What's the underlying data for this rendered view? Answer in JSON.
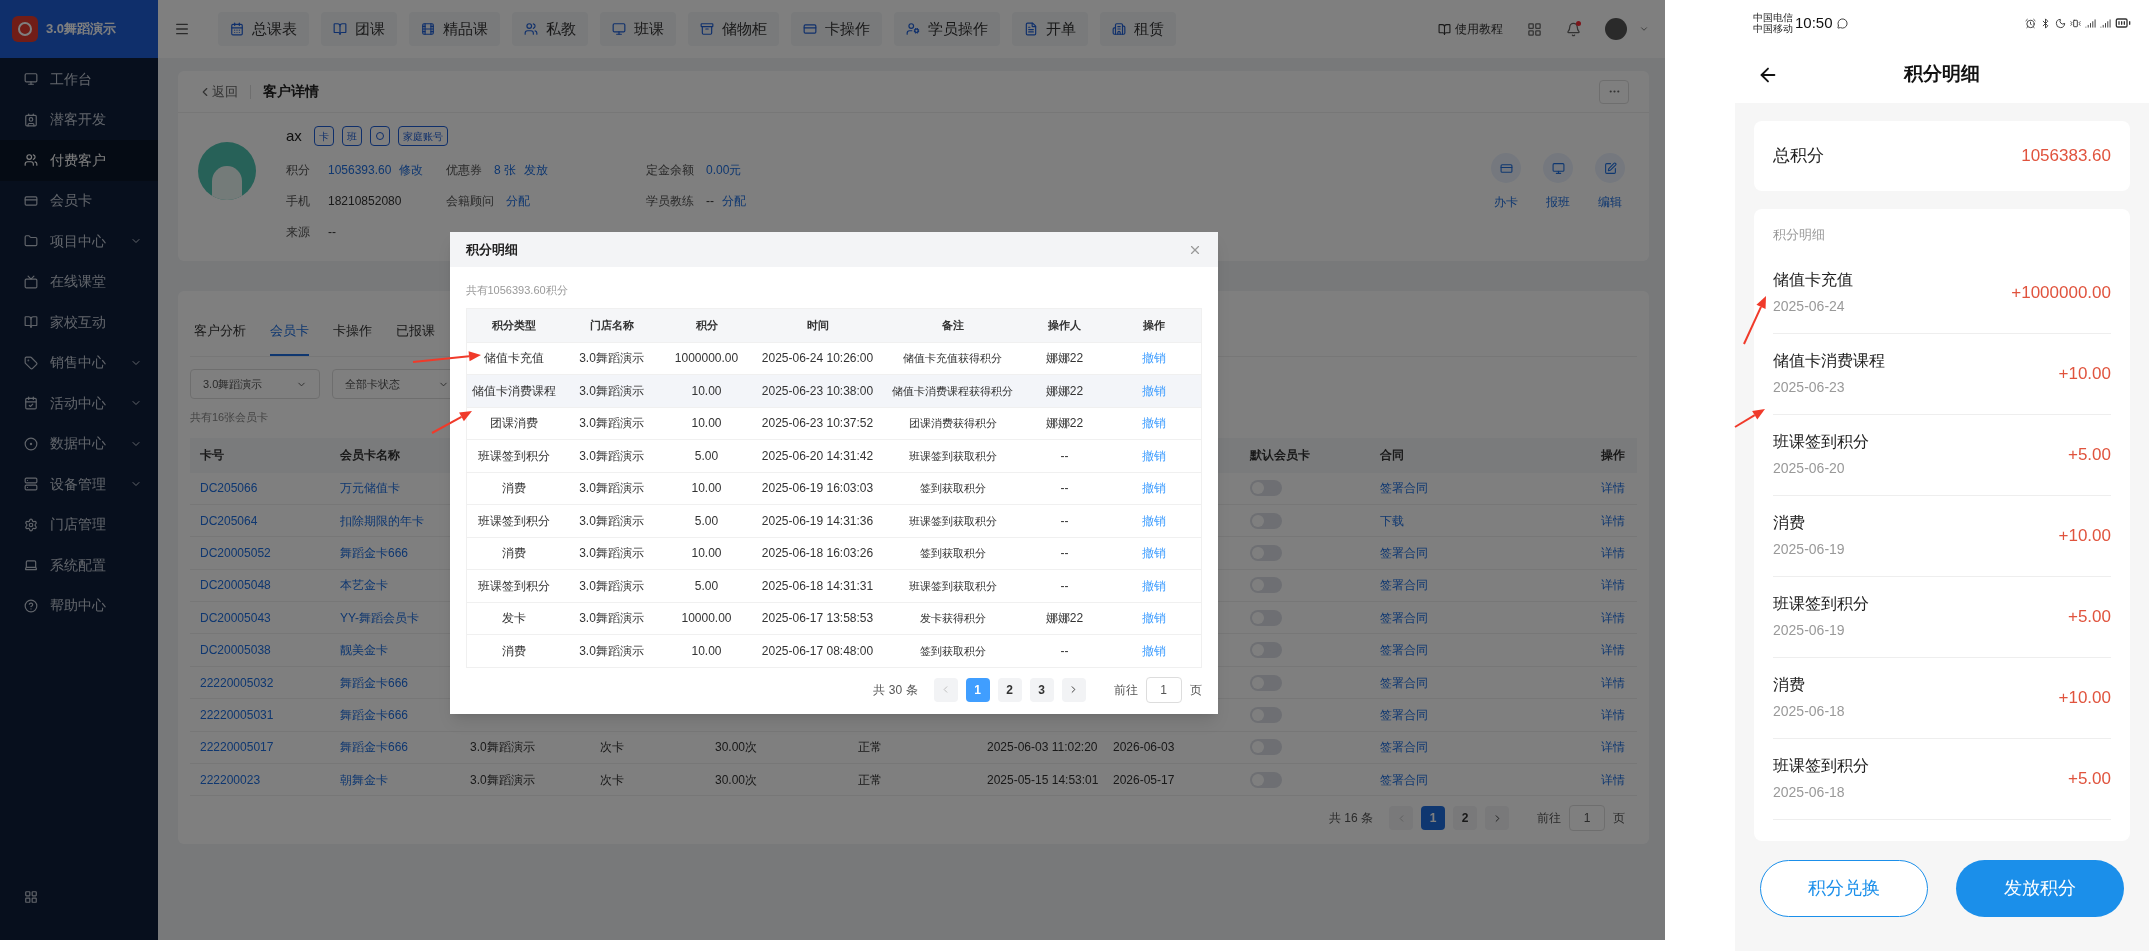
{
  "app": {
    "logo": "3.0舞蹈演示"
  },
  "sidebar": {
    "items": [
      {
        "label": "工作台",
        "kind": "link",
        "selected": false
      },
      {
        "label": "潜客开发",
        "kind": "link",
        "selected": false
      },
      {
        "label": "付费客户",
        "kind": "link",
        "selected": true
      },
      {
        "label": "会员卡",
        "kind": "link",
        "selected": false
      },
      {
        "label": "项目中心",
        "kind": "group",
        "selected": false
      },
      {
        "label": "在线课堂",
        "kind": "link",
        "selected": false
      },
      {
        "label": "家校互动",
        "kind": "link",
        "selected": false
      },
      {
        "label": "销售中心",
        "kind": "group",
        "selected": false
      },
      {
        "label": "活动中心",
        "kind": "group",
        "selected": false
      },
      {
        "label": "数据中心",
        "kind": "group",
        "selected": false
      },
      {
        "label": "设备管理",
        "kind": "group",
        "selected": false
      },
      {
        "label": "门店管理",
        "kind": "link",
        "selected": false
      },
      {
        "label": "系统配置",
        "kind": "link",
        "selected": false
      },
      {
        "label": "帮助中心",
        "kind": "link",
        "selected": false
      }
    ]
  },
  "top_nav": {
    "items": [
      "总课表",
      "团课",
      "精品课",
      "私教",
      "班课",
      "储物柜",
      "卡操作",
      "学员操作",
      "开单",
      "租赁"
    ],
    "help": "使用教程"
  },
  "customer": {
    "back": "返回",
    "title": "客户详情",
    "name": "ax",
    "tags": [
      {
        "kind": "text",
        "label": "卡"
      },
      {
        "kind": "text",
        "label": "班"
      },
      {
        "kind": "icon"
      },
      {
        "kind": "text",
        "label": "家庭账号"
      }
    ],
    "fields": [
      {
        "label": "积分",
        "value": "1056393.60",
        "linked": true,
        "action": "修改"
      },
      {
        "label": "优惠券",
        "value": "8 张",
        "linked": true,
        "action": "发放"
      },
      {
        "label": "定金余额",
        "value": "0.00元",
        "linked": true
      },
      {
        "label": "手机",
        "value": "18210852080",
        "linked": false
      },
      {
        "label": "会籍顾问",
        "action": "分配"
      },
      {
        "label": "学员教练",
        "value": "--",
        "linked": false,
        "action": "分配"
      },
      {
        "label": "来源",
        "value": "--",
        "linked": false
      }
    ],
    "actions": [
      "办卡",
      "报班",
      "编辑"
    ]
  },
  "cards_panel": {
    "tabs": [
      {
        "label": "客户分析",
        "selected": false
      },
      {
        "label": "会员卡",
        "selected": true
      },
      {
        "label": "卡操作",
        "selected": false
      },
      {
        "label": "已报课",
        "selected": false
      }
    ],
    "filters": [
      "3.0舞蹈演示",
      "全部卡状态"
    ],
    "count": "共有16张会员卡",
    "columns": {
      "card_no": "卡号",
      "card_name": "会员卡名称",
      "default_card": "默认会员卡",
      "contract": "合同",
      "action": "操作"
    },
    "rows": [
      {
        "card_no": "DC205066",
        "card_name": "万元储值卡",
        "default_card": false,
        "contract": "签署合同",
        "action": "详情"
      },
      {
        "card_no": "DC205064",
        "card_name": "扣除期限的年卡",
        "default_card": false,
        "contract": "下载",
        "action": "详情"
      },
      {
        "card_no": "DC20005052",
        "card_name": "舞蹈金卡666",
        "default_card": false,
        "contract": "签署合同",
        "action": "详情"
      },
      {
        "card_no": "DC20005048",
        "card_name": "本艺金卡",
        "default_card": false,
        "contract": "签署合同",
        "action": "详情"
      },
      {
        "card_no": "DC20005043",
        "card_name": "YY-舞蹈会员卡",
        "default_card": false,
        "contract": "签署合同",
        "action": "详情"
      },
      {
        "card_no": "DC20005038",
        "card_name": "靓美金卡",
        "default_card": false,
        "contract": "签署合同",
        "action": "详情"
      },
      {
        "card_no": "22220005032",
        "card_name": "舞蹈金卡666",
        "default_card": false,
        "contract": "签署合同",
        "action": "详情"
      },
      {
        "card_no": "22220005031",
        "card_name": "舞蹈金卡666",
        "default_card": false,
        "contract": "签署合同",
        "action": "详情"
      },
      {
        "card_no": "22220005017",
        "card_name": "舞蹈金卡666",
        "column_3": "3.0舞蹈演示",
        "column_4": "次卡",
        "column_5": "30.00次",
        "column_6": "正常",
        "column_7": "2025-06-03 11:02:20",
        "column_8": "2026-06-03",
        "default_card": false,
        "contract": "签署合同",
        "action": "详情"
      },
      {
        "card_no": "222200023",
        "card_name": "朝舞金卡",
        "column_3": "3.0舞蹈演示",
        "column_4": "次卡",
        "column_5": "30.00次",
        "column_6": "正常",
        "column_7": "2025-05-15 14:53:01",
        "column_8": "2026-05-17",
        "default_card": false,
        "contract": "签署合同",
        "action": "详情"
      }
    ],
    "pagination": {
      "total": "共 16 条",
      "pages": [
        {
          "label": "1",
          "selected": true
        },
        {
          "label": "2",
          "selected": false
        }
      ],
      "goto": "前往",
      "page_input": "1",
      "suffix": "页"
    }
  },
  "points_dialog": {
    "title": "积分明细",
    "summary": "共有1056393.60积分",
    "columns": [
      "积分类型",
      "门店名称",
      "积分",
      "时间",
      "备注",
      "操作人",
      "操作"
    ],
    "rows": [
      {
        "type": "储值卡充值",
        "store": "3.0舞蹈演示",
        "points": "1000000.00",
        "time": "2025-06-24 10:26:00",
        "note": "储值卡充值获得积分",
        "operator": "娜娜22",
        "action": "撤销",
        "highlighted": false
      },
      {
        "type": "储值卡消费课程",
        "store": "3.0舞蹈演示",
        "points": "10.00",
        "time": "2025-06-23 10:38:00",
        "note": "储值卡消费课程获得积分",
        "operator": "娜娜22",
        "action": "撤销",
        "highlighted": true
      },
      {
        "type": "团课消费",
        "store": "3.0舞蹈演示",
        "points": "10.00",
        "time": "2025-06-23 10:37:52",
        "note": "团课消费获得积分",
        "operator": "娜娜22",
        "action": "撤销",
        "highlighted": false
      },
      {
        "type": "班课签到积分",
        "store": "3.0舞蹈演示",
        "points": "5.00",
        "time": "2025-06-20 14:31:42",
        "note": "班课签到获取积分",
        "operator": "--",
        "action": "撤销",
        "highlighted": false
      },
      {
        "type": "消费",
        "store": "3.0舞蹈演示",
        "points": "10.00",
        "time": "2025-06-19 16:03:03",
        "note": "签到获取积分",
        "operator": "--",
        "action": "撤销",
        "highlighted": false
      },
      {
        "type": "班课签到积分",
        "store": "3.0舞蹈演示",
        "points": "5.00",
        "time": "2025-06-19 14:31:36",
        "note": "班课签到获取积分",
        "operator": "--",
        "action": "撤销",
        "highlighted": false
      },
      {
        "type": "消费",
        "store": "3.0舞蹈演示",
        "points": "10.00",
        "time": "2025-06-18 16:03:26",
        "note": "签到获取积分",
        "operator": "--",
        "action": "撤销",
        "highlighted": false
      },
      {
        "type": "班课签到积分",
        "store": "3.0舞蹈演示",
        "points": "5.00",
        "time": "2025-06-18 14:31:31",
        "note": "班课签到获取积分",
        "operator": "--",
        "action": "撤销",
        "highlighted": false
      },
      {
        "type": "发卡",
        "store": "3.0舞蹈演示",
        "points": "10000.00",
        "time": "2025-06-17 13:58:53",
        "note": "发卡获得积分",
        "operator": "娜娜22",
        "action": "撤销",
        "highlighted": false
      },
      {
        "type": "消费",
        "store": "3.0舞蹈演示",
        "points": "10.00",
        "time": "2025-06-17 08:48:00",
        "note": "签到获取积分",
        "operator": "--",
        "action": "撤销",
        "highlighted": false
      }
    ],
    "pagination": {
      "total": "共 30 条",
      "pages": [
        {
          "label": "1",
          "selected": true
        },
        {
          "label": "2",
          "selected": false
        },
        {
          "label": "3",
          "selected": false
        }
      ],
      "goto": "前往",
      "page_input": "1",
      "suffix": "页"
    }
  },
  "phone": {
    "status_bar": {
      "carriers": [
        "中国电信",
        "中国移动"
      ],
      "time": "10:50"
    },
    "title": "积分明细",
    "total": {
      "label": "总积分",
      "value": "1056383.60"
    },
    "section_title": "积分明细",
    "items": [
      {
        "title": "储值卡充值",
        "date": "2025-06-24",
        "amount": "+1000000.00"
      },
      {
        "title": "储值卡消费课程",
        "date": "2025-06-23",
        "amount": "+10.00"
      },
      {
        "title": "班课签到积分",
        "date": "2025-06-20",
        "amount": "+5.00"
      },
      {
        "title": "消费",
        "date": "2025-06-19",
        "amount": "+10.00"
      },
      {
        "title": "班课签到积分",
        "date": "2025-06-19",
        "amount": "+5.00"
      },
      {
        "title": "消费",
        "date": "2025-06-18",
        "amount": "+10.00"
      },
      {
        "title": "班课签到积分",
        "date": "2025-06-18",
        "amount": "+5.00"
      }
    ],
    "buttons": [
      {
        "label": "积分兑换",
        "kind": "outline"
      },
      {
        "label": "发放积分",
        "kind": "primary"
      }
    ]
  }
}
